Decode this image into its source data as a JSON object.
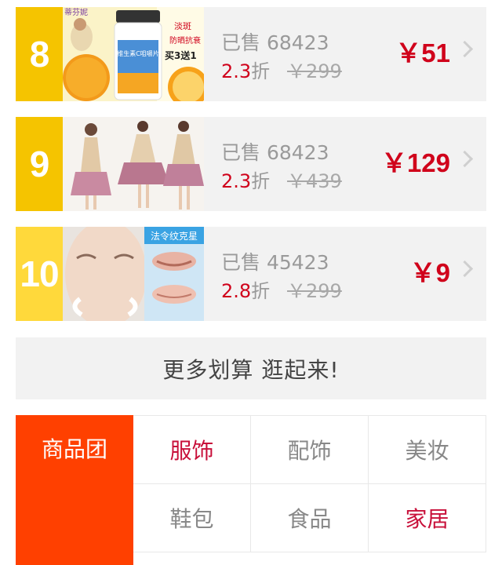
{
  "deals": [
    {
      "rank": "8",
      "rank_color": "#f5c400",
      "sold": "已售 68423",
      "discount": "2.3",
      "discount_unit": "折",
      "original": "￥299",
      "price": "￥51",
      "image": {
        "brand": "蒂芬妮",
        "product": "维生素C咀嚼片",
        "promo1": "淡斑",
        "promo2": "防晒抗衰",
        "promo3": "买3送1"
      }
    },
    {
      "rank": "9",
      "rank_color": "#f5c400",
      "sold": "已售 68423",
      "discount": "2.3",
      "discount_unit": "折",
      "original": "￥439",
      "price": "￥129",
      "image": {}
    },
    {
      "rank": "10",
      "rank_color": "#ffd93b",
      "sold": "已售 45423",
      "discount": "2.8",
      "discount_unit": "折",
      "original": "￥299",
      "price": "￥9",
      "image": {
        "caption": "法令纹克星"
      }
    }
  ],
  "more_button": "更多划算  逛起来!",
  "category": {
    "title": "商品团",
    "items": [
      {
        "label": "服饰",
        "highlight": true
      },
      {
        "label": "配饰",
        "highlight": false
      },
      {
        "label": "美妆",
        "highlight": false
      },
      {
        "label": "鞋包",
        "highlight": false
      },
      {
        "label": "食品",
        "highlight": false
      },
      {
        "label": "家居",
        "highlight": true
      }
    ]
  },
  "colors": {
    "accent": "#d0021b",
    "category_bg": "#ff4000",
    "panel_bg": "#f2f2f2"
  }
}
